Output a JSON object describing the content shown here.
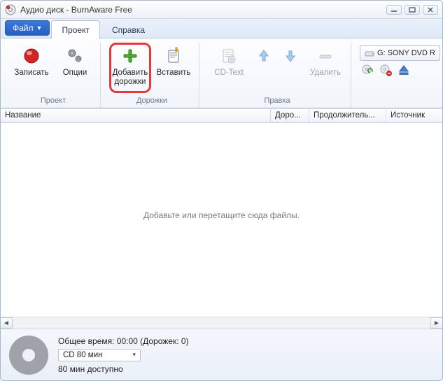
{
  "window": {
    "title": "Аудио диск - BurnAware Free"
  },
  "tabs": {
    "file": "Файл",
    "project": "Проект",
    "help": "Справка"
  },
  "ribbon": {
    "groups": {
      "project": {
        "label": "Проект",
        "burn": "Записать",
        "options": "Опции"
      },
      "tracks": {
        "label": "Дорожки",
        "add": "Добавить\nдорожки",
        "insert": "Вставить"
      },
      "edit": {
        "label": "Правка",
        "cdtext": "CD-Text",
        "delete": "Удалить"
      }
    }
  },
  "drive": {
    "label": "G: SONY DVD R"
  },
  "columns": {
    "name": "Название",
    "tracks": "Доро...",
    "duration": "Продолжитель...",
    "source": "Источник"
  },
  "content": {
    "placeholder": "Добавьте или перетащите сюда файлы."
  },
  "footer": {
    "total": "Общее время: 00:00 (Дорожек: 0)",
    "preset": "CD 80 мин",
    "available": "80 мин доступно"
  }
}
